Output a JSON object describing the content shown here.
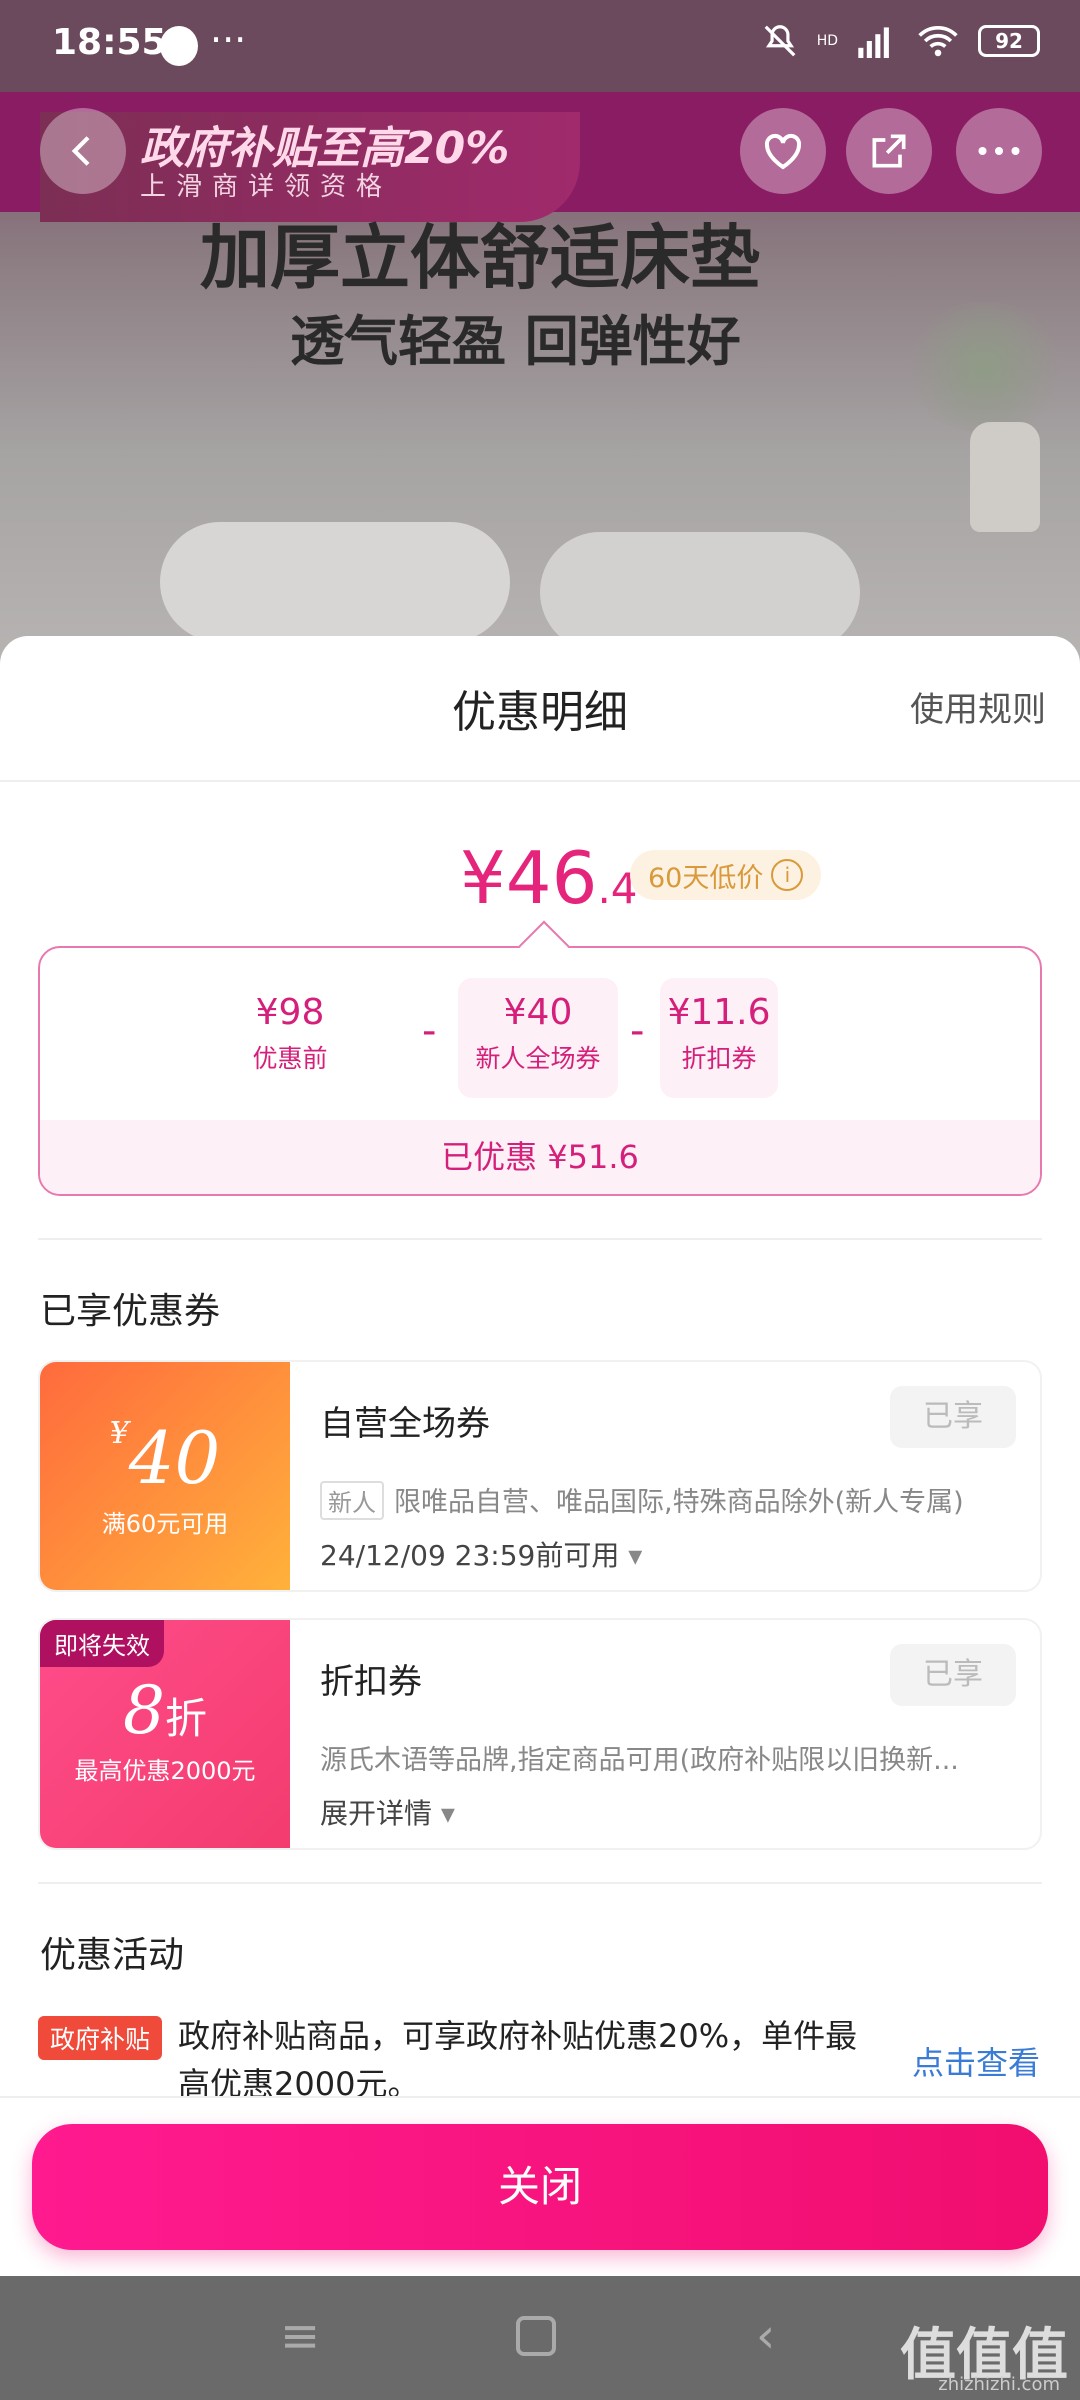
{
  "status_bar": {
    "time": "18:55",
    "more": "···",
    "battery": "92",
    "hd": "HD"
  },
  "hero": {
    "banner_title": "政府补贴至高20%",
    "banner_sub": "上滑商详领资格",
    "headline": "加厚立体舒适床垫",
    "tagline": "透气轻盈 回弹性好",
    "icons": [
      "back-icon",
      "favorite-icon",
      "share-icon",
      "more-icon"
    ]
  },
  "sheet": {
    "title": "优惠明细",
    "rules_link": "使用规则",
    "final_price": "¥46",
    "final_price_decimal": ".4",
    "low_price_tag": "60天低价",
    "breakdown": [
      {
        "value": "¥98",
        "label": "优惠前"
      },
      {
        "value": "¥40",
        "label": "新人全场券"
      },
      {
        "value": "¥11.6",
        "label": "折扣券"
      }
    ],
    "minus": "-",
    "saved": "已优惠 ¥51.6"
  },
  "coupons_section": {
    "title": "已享优惠券",
    "coupons": [
      {
        "amount_symbol": "¥",
        "amount": "40",
        "condition": "满60元可用",
        "name": "自营全场券",
        "status": "已享",
        "tag": "新人",
        "desc": "限唯品自营、唯品国际,特殊商品除外(新人专属)",
        "when": "24/12/09 23:59前可用"
      },
      {
        "expiring": "即将失效",
        "amount": "8",
        "unit": "折",
        "condition": "最高优惠2000元",
        "name": "折扣券",
        "status": "已享",
        "desc": "源氏木语等品牌,指定商品可用(政府补贴限以旧换新...",
        "when": "展开详情"
      }
    ]
  },
  "activity_section": {
    "title": "优惠活动",
    "tag": "政府补贴",
    "desc": "政府补贴商品，可享政府补贴优惠20%，单件最高优惠2000元。",
    "link": "点击查看"
  },
  "close_button": "关闭",
  "watermark": {
    "logo": "值值值",
    "site": "zhizhizhi.com"
  },
  "colors": {
    "accent": "#e5247b",
    "button": "#ff1b8f"
  }
}
